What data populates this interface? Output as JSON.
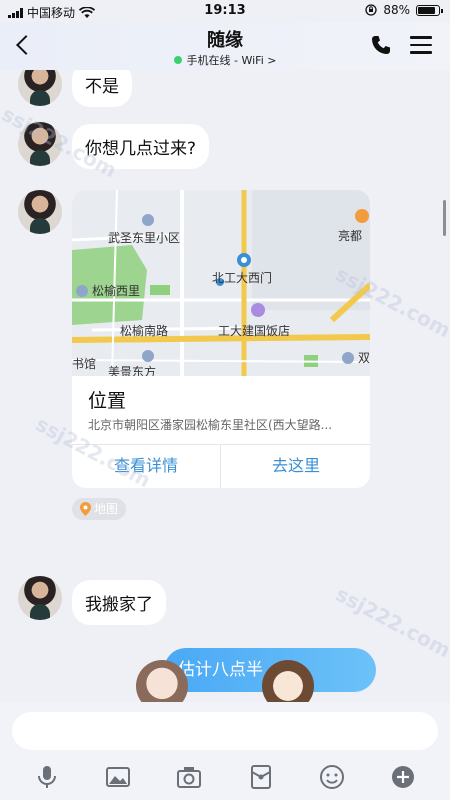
{
  "status_bar": {
    "carrier": "中国移动",
    "time": "19:13",
    "battery": "88%"
  },
  "header": {
    "title": "随缘",
    "status": "手机在线 - WiFi",
    "status_arrow": ">"
  },
  "messages": [
    {
      "from": "contact",
      "text": "不是"
    },
    {
      "from": "contact",
      "text": "你想几点过来?"
    },
    {
      "from": "contact",
      "text": "我搬家了"
    },
    {
      "from": "me",
      "text": "估计八点半"
    }
  ],
  "location_card": {
    "title": "位置",
    "address": "北京市朝阳区潘家园松榆东里社区(西大望路...",
    "view_details": "查看详情",
    "go_here": "去这里",
    "tag": "地图",
    "map_labels": {
      "community": "武圣东里小区",
      "songyu_xili": "松榆西里",
      "songyu_south_road": "松榆南路",
      "gongda_west_gate": "北工大西门",
      "hotel": "工大建国饭店",
      "mall": "亮都",
      "left_edge": "书馆",
      "bottom_left": "美景东方",
      "right_edge": "双"
    }
  },
  "watermark": "ssj222.com",
  "colors": {
    "accent": "#3a8fd6",
    "sent_bubble": "#4aa8f5",
    "online": "#3bd16f",
    "background": "#eef0f6"
  },
  "toolbar_icons": [
    "mic-icon",
    "image-icon",
    "camera-icon",
    "red-packet-icon",
    "emoji-icon",
    "plus-icon"
  ]
}
